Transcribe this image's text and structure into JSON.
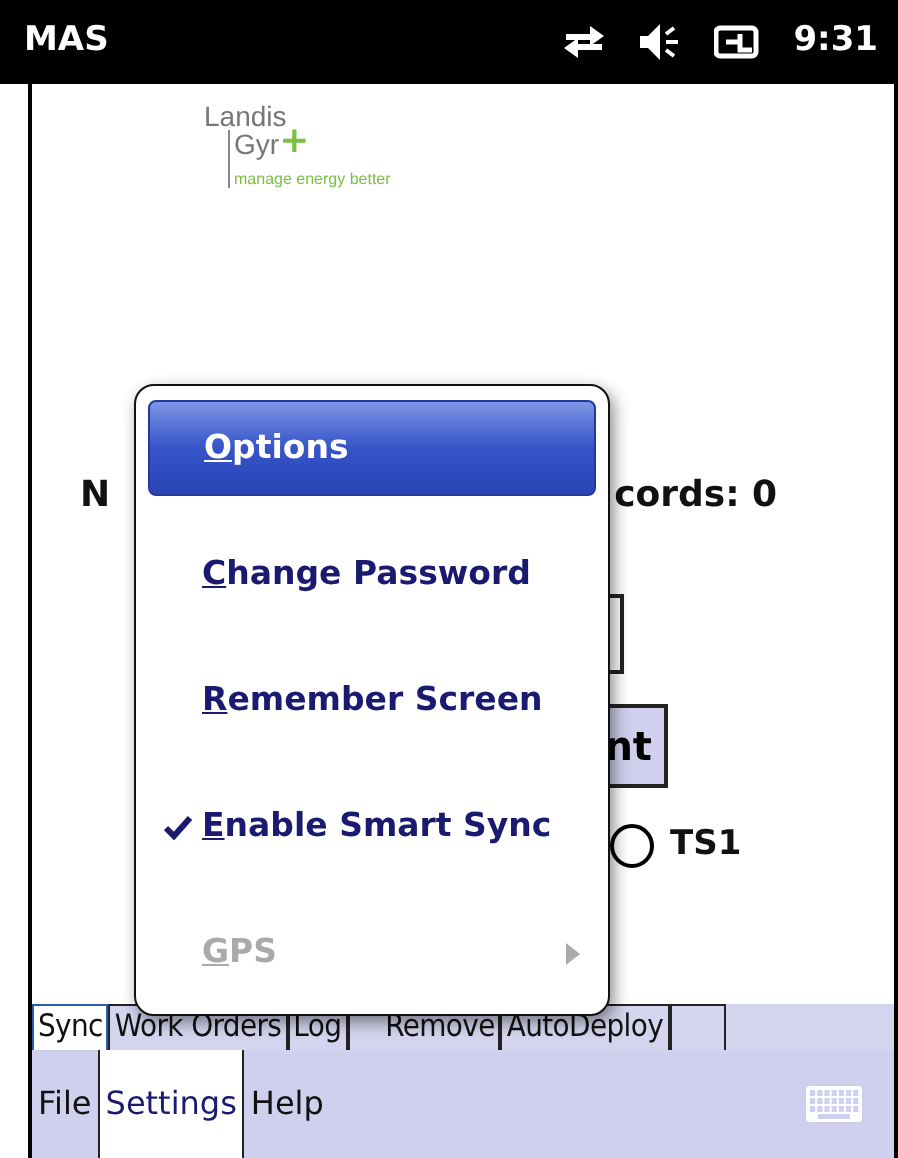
{
  "status_bar": {
    "title": "MAS",
    "time": "9:31"
  },
  "logo": {
    "line1": "Landis",
    "line2": "Gyr",
    "mark": "+",
    "tagline": "manage energy better"
  },
  "background": {
    "label_left": "N",
    "label_right": "cords: 0",
    "button": "nt",
    "radio": {
      "label": "TS1",
      "checked": false
    }
  },
  "popup_menu": [
    {
      "label": "Options",
      "kind": "item",
      "selected": true,
      "checked": false,
      "disabled": false
    },
    {
      "label": "Change Password",
      "kind": "item",
      "selected": false,
      "checked": false,
      "disabled": false
    },
    {
      "label": "Remember Screen",
      "kind": "item",
      "selected": false,
      "checked": false,
      "disabled": false
    },
    {
      "label": "Enable Smart Sync",
      "kind": "item",
      "selected": false,
      "checked": true,
      "disabled": false
    },
    {
      "label": "GPS",
      "kind": "submenu",
      "selected": false,
      "checked": false,
      "disabled": true
    }
  ],
  "tabs": [
    {
      "label": "Sync",
      "selected": true
    },
    {
      "label": "Work Orders",
      "selected": false
    },
    {
      "label": "Log",
      "selected": false
    },
    {
      "label": "Remove",
      "selected": false
    },
    {
      "label": "AutoDeploy",
      "selected": false
    }
  ],
  "menu_bar": [
    {
      "label": "File",
      "selected": false
    },
    {
      "label": "Settings",
      "selected": true
    },
    {
      "label": "Help",
      "selected": false
    }
  ]
}
